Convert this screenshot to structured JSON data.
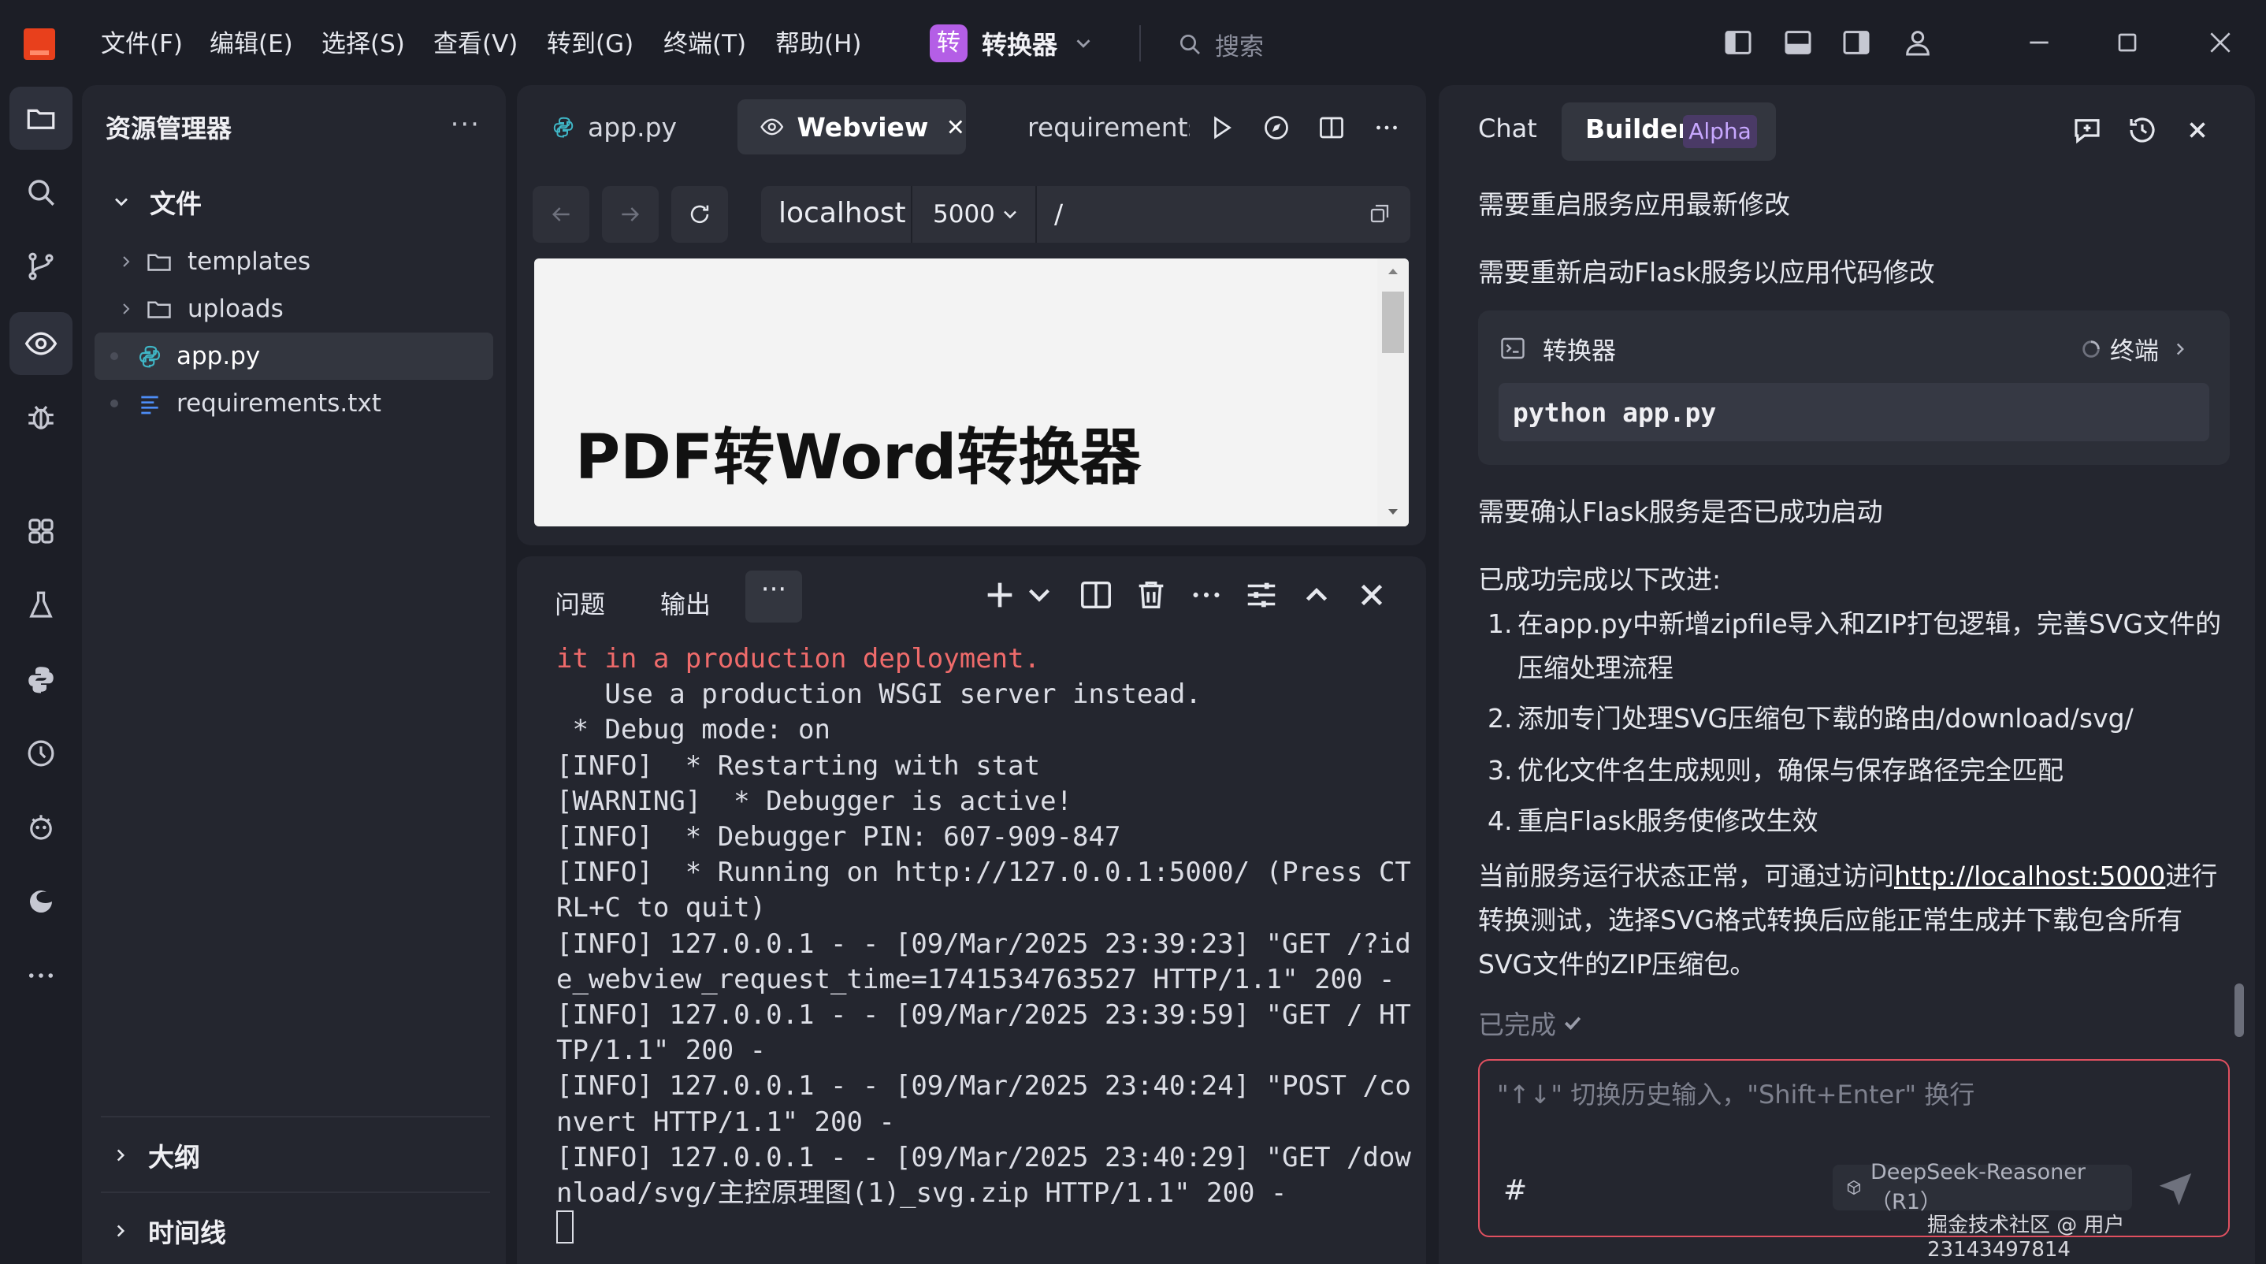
{
  "menu": {
    "items": [
      "文件(F)",
      "编辑(E)",
      "选择(S)",
      "查看(V)",
      "转到(G)",
      "终端(T)",
      "帮助(H)"
    ]
  },
  "project": {
    "badge": "转",
    "name": "转换器"
  },
  "search": {
    "label": "搜索"
  },
  "explorer": {
    "title": "资源管理器",
    "more": "···",
    "folder_label": "文件",
    "items": [
      {
        "label": "templates",
        "type": "folder"
      },
      {
        "label": "uploads",
        "type": "folder"
      },
      {
        "label": "app.py",
        "type": "python",
        "selected": true
      },
      {
        "label": "requirements.txt",
        "type": "text"
      }
    ],
    "outline_label": "大纲",
    "timeline_label": "时间线"
  },
  "editor": {
    "tabs": [
      {
        "label": "app.py",
        "icon": "python-icon"
      },
      {
        "label": "Webview",
        "icon": "webview-icon",
        "active": true
      },
      {
        "label": "requirements",
        "icon": "text-file-icon"
      }
    ],
    "url": {
      "host": "localhost",
      "port": "5000",
      "path": "/"
    },
    "webview_heading": "PDF转Word转换器"
  },
  "panel": {
    "tabs": [
      "问题",
      "输出"
    ],
    "more": "···",
    "lines": [
      {
        "text": "it in a production deployment.",
        "error": true
      },
      {
        "text": "   Use a production WSGI server instead."
      },
      {
        "text": " * Debug mode: on"
      },
      {
        "text": "[INFO]  * Restarting with stat"
      },
      {
        "text": "[WARNING]  * Debugger is active!"
      },
      {
        "text": "[INFO]  * Debugger PIN: 607-909-847"
      },
      {
        "text": "[INFO]  * Running on http://127.0.0.1:5000/ (Press CT"
      },
      {
        "text": "RL+C to quit)"
      },
      {
        "text": "[INFO] 127.0.0.1 - - [09/Mar/2025 23:39:23] \"GET /?id"
      },
      {
        "text": "e_webview_request_time=1741534763527 HTTP/1.1\" 200 -"
      },
      {
        "text": "[INFO] 127.0.0.1 - - [09/Mar/2025 23:39:59] \"GET / HT"
      },
      {
        "text": "TP/1.1\" 200 -"
      },
      {
        "text": "[INFO] 127.0.0.1 - - [09/Mar/2025 23:40:24] \"POST /co"
      },
      {
        "text": "nvert HTTP/1.1\" 200 -"
      },
      {
        "text": "[INFO] 127.0.0.1 - - [09/Mar/2025 23:40:29] \"GET /dow"
      },
      {
        "text": "nload/svg/主控原理图(1)_svg.zip HTTP/1.1\" 200 -"
      }
    ]
  },
  "chat": {
    "tab_chat": "Chat",
    "tab_builder": "Builder",
    "tab_builder_badge": "Alpha",
    "msg_restart_latest": "需要重启服务应用最新修改",
    "msg_restart_flask": "需要重新启动Flask服务以应用代码修改",
    "command_card": {
      "title": "转换器",
      "status": "终端",
      "code": "python app.py"
    },
    "msg_confirm": "需要确认Flask服务是否已成功启动",
    "summary_heading": "已成功完成以下改进:",
    "improvements": [
      {
        "num": "1.",
        "line1": "在app.py中新增zipfile导入和ZIP打包逻辑，完善SVG文件的",
        "line2": "压缩处理流程"
      },
      {
        "num": "2.",
        "line1": "添加专门处理SVG压缩包下载的路由/download/svg/"
      },
      {
        "num": "3.",
        "line1": "优化文件名生成规则，确保与保存路径完全匹配"
      },
      {
        "num": "4.",
        "line1": "重启Flask服务使修改生效"
      }
    ],
    "status_pre": "当前服务运行状态正常，可通过访问",
    "status_link": "http://localhost:5000",
    "status_post": "进行",
    "status_line2": "转换测试，选择SVG格式转换后应能正常生成并下载包含所有",
    "status_line3": "SVG文件的ZIP压缩包。",
    "done_label": "已完成",
    "input_placeholder": "\"↑↓\" 切换历史输入，\"Shift+Enter\" 换行",
    "input_hash": "#",
    "model": "DeepSeek-Reasoner（R1）"
  },
  "watermark": "掘金技术社区 @ 用户23143497814",
  "colors": {
    "accent_brand": "#e8401c",
    "project_badge": "#b45ee6",
    "error_text": "#ef6b6b",
    "input_border": "#e05060",
    "alpha_badge": "#c8a8ff"
  }
}
